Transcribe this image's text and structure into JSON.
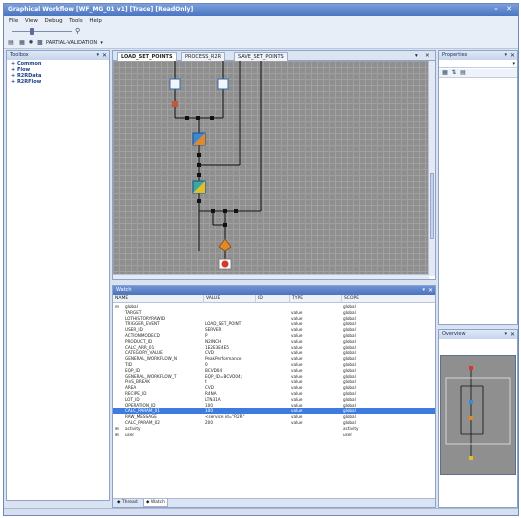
{
  "window": {
    "title": "Graphical Workflow [WF_MG_01 v1] [Trace] [ReadOnly]",
    "minimize": "–",
    "close": "✕"
  },
  "menu": [
    "File",
    "View",
    "Debug",
    "Tools",
    "Help"
  ],
  "toolbar": {
    "mode_label": "PARTIAL-VALIDATION",
    "icons": [
      "save-icon",
      "tree-icon",
      "settings-icon",
      "grid-icon"
    ]
  },
  "toolbox": {
    "title": "Toolbox",
    "pin": "▾",
    "close": "✕",
    "items": [
      "Common",
      "Flow",
      "R2RData",
      "R2RFlow"
    ]
  },
  "designer": {
    "tabs": [
      "LOAD_SET_POINTS",
      "PROCESS_R2R",
      "SAVE_SET_POINTS"
    ],
    "menu": "▾",
    "close": "✕"
  },
  "watch": {
    "title": "Watch",
    "pin": "▾",
    "close": "✕",
    "columns": [
      "NAME",
      "VALUE",
      "ID",
      "TYPE",
      "SCOPE"
    ],
    "rows": [
      {
        "expander": "⊟",
        "name": "global",
        "value": "",
        "id": "",
        "type": "",
        "scope": "global"
      },
      {
        "expander": "",
        "name": "TARGET",
        "value": "",
        "id": "",
        "type": "value",
        "scope": "global"
      },
      {
        "expander": "",
        "name": "LOTHISTORYRAWID",
        "value": "",
        "id": "",
        "type": "value",
        "scope": "global"
      },
      {
        "expander": "",
        "name": "TRIGGER_EVENT",
        "value": "LOAD_SET_POINT",
        "id": "",
        "type": "value",
        "scope": "global"
      },
      {
        "expander": "",
        "name": "USER_ID",
        "value": "SERVER",
        "id": "",
        "type": "value",
        "scope": "global"
      },
      {
        "expander": "",
        "name": "ACTIONMODECD",
        "value": "P",
        "id": "",
        "type": "value",
        "scope": "global"
      },
      {
        "expander": "",
        "name": "PRODUCT_ID",
        "value": "N2INCH",
        "id": "",
        "type": "value",
        "scope": "global"
      },
      {
        "expander": "",
        "name": "CALC_ARR_01",
        "value": "1E2E3E4E5",
        "id": "",
        "type": "value",
        "scope": "global"
      },
      {
        "expander": "",
        "name": "CATEGORY_VALUE",
        "value": "CVD",
        "id": "",
        "type": "value",
        "scope": "global"
      },
      {
        "expander": "",
        "name": "GENERAL_WORKFLOW_N",
        "value": "PeakPerformance",
        "id": "",
        "type": "value",
        "scope": "global"
      },
      {
        "expander": "",
        "name": "TID",
        "value": "0",
        "id": "",
        "type": "value",
        "scope": "global"
      },
      {
        "expander": "",
        "name": "EQP_ID",
        "value": "BCVD04",
        "id": "",
        "type": "value",
        "scope": "global"
      },
      {
        "expander": "",
        "name": "GENERAL_WORKFLOW_T",
        "value": "EQP_ID=BCVD04;",
        "id": "",
        "type": "value",
        "scope": "global"
      },
      {
        "expander": "",
        "name": "PinS_BREAK",
        "value": "t",
        "id": "",
        "type": "value",
        "scope": "global"
      },
      {
        "expander": "",
        "name": "AREA",
        "value": "CVD",
        "id": "",
        "type": "value",
        "scope": "global"
      },
      {
        "expander": "",
        "name": "RECIPE_ID",
        "value": "R4NA",
        "id": "",
        "type": "value",
        "scope": "global"
      },
      {
        "expander": "",
        "name": "LOT_ID",
        "value": "LTN31A",
        "id": "",
        "type": "value",
        "scope": "global"
      },
      {
        "expander": "",
        "name": "OPERATION_ID",
        "value": "100",
        "id": "",
        "type": "value",
        "scope": "global"
      },
      {
        "expander": "",
        "name": "CALC_PARAM_01",
        "value": "100",
        "id": "",
        "type": "value",
        "scope": "global",
        "selected": true
      },
      {
        "expander": "",
        "name": "RAW_MESSAGE",
        "value": "<service id=\"R2R\"",
        "id": "",
        "type": "value",
        "scope": "global"
      },
      {
        "expander": "",
        "name": "CALC_PARAM_02",
        "value": "200",
        "id": "",
        "type": "value",
        "scope": "global"
      },
      {
        "expander": "⊞",
        "name": "activity",
        "value": "",
        "id": "",
        "type": "",
        "scope": "activity"
      },
      {
        "expander": "⊞",
        "name": "user",
        "value": "",
        "id": "",
        "type": "",
        "scope": "user"
      }
    ],
    "bottom_tabs": [
      "Thread",
      "Watch"
    ]
  },
  "properties": {
    "title": "Properties",
    "pin": "▾",
    "close": "✕",
    "dropdown_arrow": "▾"
  },
  "overview": {
    "title": "Overview",
    "pin": "▾",
    "close": "✕"
  },
  "colors": {
    "title_bar": "#5b82cc",
    "canvas": "#8f8f8f",
    "selection": "#3d7be0",
    "node_orange": "#e08a2a",
    "node_blue": "#3a8ad8",
    "node_red": "#d43a2a"
  }
}
